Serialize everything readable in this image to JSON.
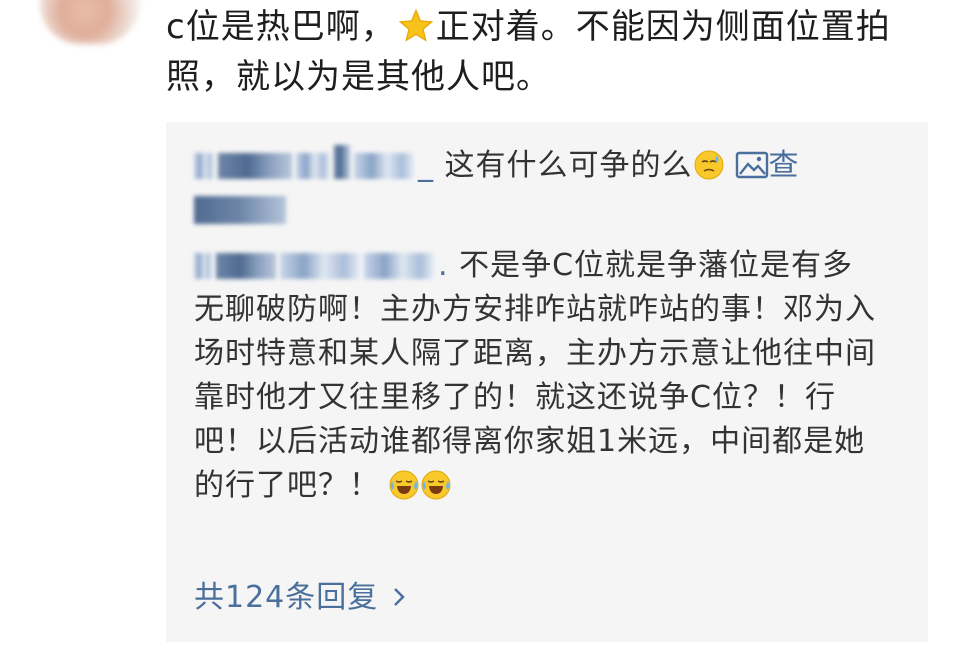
{
  "main_comment": {
    "text_part1": "c位是热巴啊，",
    "star_icon": "star-emoji",
    "text_part2": "正对着。不能因为侧面位置拍照，就以为是其他人吧。"
  },
  "replies": [
    {
      "username_suffix": "_",
      "text": " 这有什么可争的么",
      "emoji_icon": "sweat-emoji",
      "image_link_label": "查"
    },
    {
      "username_suffix": ".",
      "text": " 不是争C位就是争藩位是有多无聊破防啊！主办方安排咋站就咋站的事！邓为入场时特意和某人隔了距离，主办方示意让他往中间靠时他才又往里移了的！就这还说争C位？！行吧！以后活动谁都得离你家姐1米远，中间都是她的行了吧？！",
      "emoji_icon": "laugh-cry-emoji"
    }
  ],
  "more_replies_label": "共124条回复",
  "colors": {
    "link": "#4a6f9c",
    "reply_bg": "#f5f5f5",
    "text": "#333333"
  }
}
